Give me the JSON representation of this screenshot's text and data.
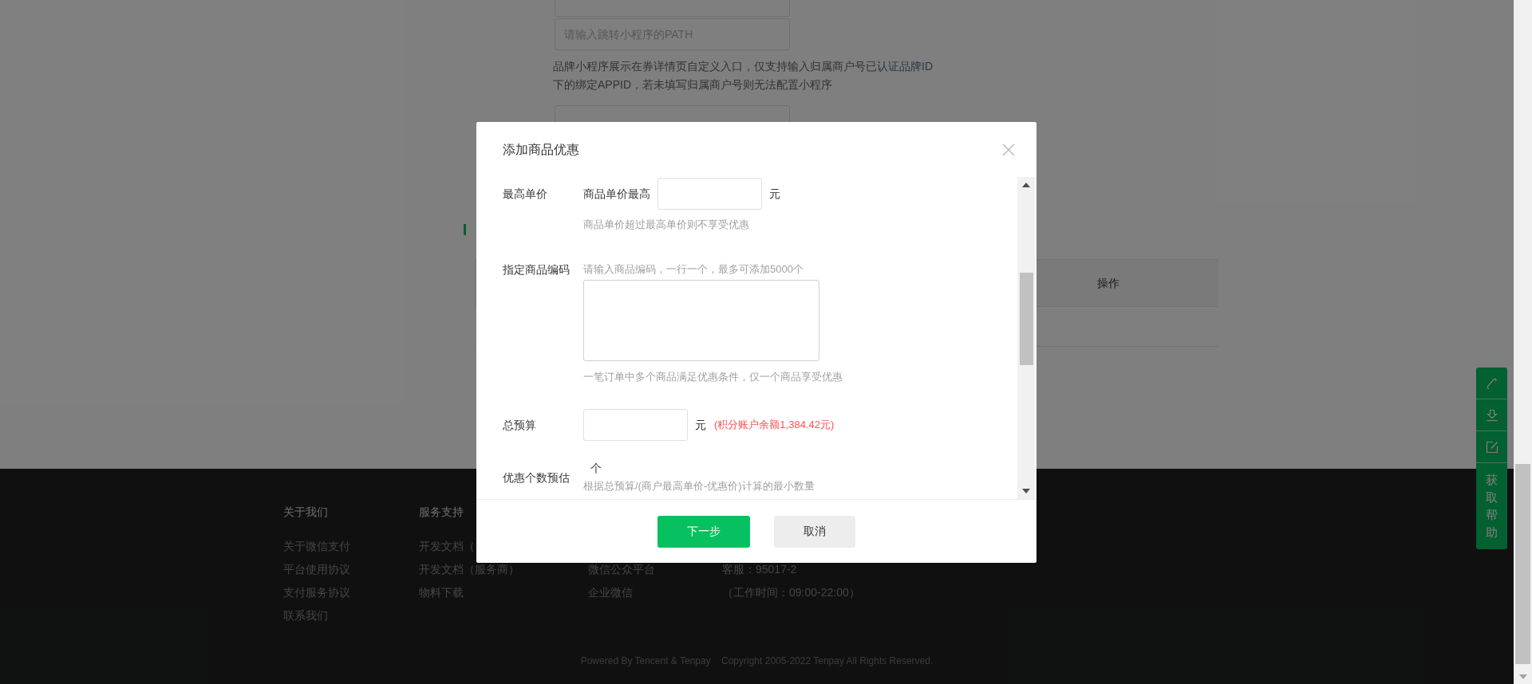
{
  "background_form": {
    "path_field": {
      "placeholder": "请输入跳转小程序的PATH"
    },
    "note": {
      "text_before": "品牌小程序展示在券详情页自定义入口，仅支持输入归属商户号已",
      "link": "认证品牌ID",
      "text_after": "下的绑定APPID，若未填写归属商户号则无法配置小程序"
    }
  },
  "table": {
    "columns": [
      "操作"
    ]
  },
  "footer": {
    "columns": [
      {
        "title": "关于我们",
        "links": [
          "关于微信支付",
          "平台使用协议",
          "支付服务协议",
          "联系我们"
        ]
      },
      {
        "title": "服务支持",
        "links": [
          "开发文档（",
          "开发文档（服务商）",
          "物料下载"
        ]
      },
      {
        "links": [
          "微信公众平台",
          "企业微信"
        ]
      },
      {
        "links": [
          "客服：95017-2",
          "（工作时间：09:00-22:00）"
        ]
      }
    ],
    "copyright": "Powered By Tencent & Tenpay    Copyright 2005-2022 Tenpay All Rights Reserved."
  },
  "help_panel": {
    "label": "获取帮助"
  },
  "dialog": {
    "title": "添加商品优惠",
    "fields": [
      {
        "kind": "price",
        "label": "最高单价",
        "prefix": "商品单价最高",
        "unit": "元",
        "hint": "商品单价超过最高单价则不享受优惠"
      },
      {
        "kind": "codes",
        "label": "指定商品编码",
        "note": "请输入商品编码，一行一个，最多可添加5000个",
        "hint": "一笔订单中多个商品满足优惠条件，仅一个商品享受优惠"
      },
      {
        "kind": "budget",
        "label": "总预算",
        "unit": "元",
        "balance": "(积分账户余额1,384.42元)"
      },
      {
        "kind": "estimate",
        "label": "优惠个数预估",
        "unit": "个",
        "hint": "根据总预算/(商户最高单价-优惠价)计算的最小数量"
      }
    ],
    "buttons": [
      {
        "kind": "primary",
        "label": "下一步"
      },
      {
        "kind": "secondary",
        "label": "取消"
      }
    ]
  }
}
